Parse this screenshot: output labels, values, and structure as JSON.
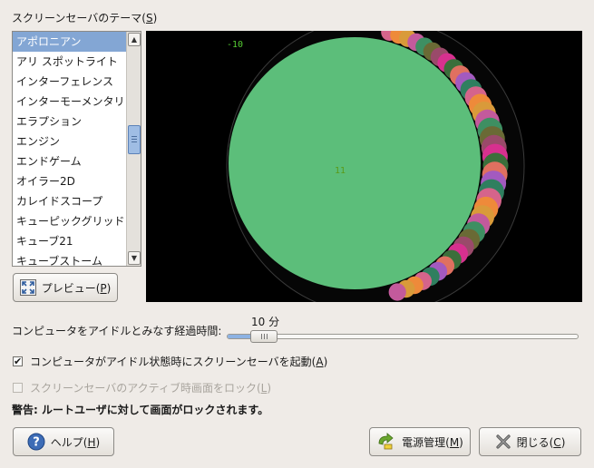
{
  "dialog": {
    "theme_heading": "スクリーンセーバのテーマ(",
    "theme_heading_mnemonic": "S",
    "themes": [
      "アポロニアン",
      "アリ スポットライト",
      "インターフェレンス",
      "インターモーメンタリ",
      "エラプション",
      "エンジン",
      "エンドゲーム",
      "オイラー2D",
      "カレイドスコープ",
      "キューピックグリッド",
      "キューブ21",
      "キューブストーム"
    ],
    "selected_theme": "アポロニアン",
    "preview_button_label": "プレビュー(",
    "preview_button_mnemonic": "P",
    "preview_text_top": "-10",
    "preview_text_center": "11",
    "idle_label": "コンピュータをアイドルとみなす経過時間:",
    "idle_value": "10 分",
    "idle_fraction": 0.11,
    "activate_label": "コンピュータがアイドル状態時にスクリーンセーバを起動(",
    "activate_mnemonic": "A",
    "activate_checked": true,
    "lock_label": "スクリーンセーバのアクティブ時画面をロック(",
    "lock_mnemonic": "L",
    "lock_checked": false,
    "warning_label": "警告:",
    "warning_text": "ルートユーザに対して画面がロックされます。",
    "help_label": "ヘルプ(",
    "help_mnemonic": "H",
    "power_label": "電源管理(",
    "power_mnemonic": "M",
    "close_label": "閉じる(",
    "close_mnemonic": "C"
  },
  "icons": {
    "preview": "fullscreen-arrows-icon",
    "help": "help-question-icon",
    "power": "power-management-icon",
    "close": "close-x-icon",
    "scroll_up": "chevron-up-icon",
    "scroll_down": "chevron-down-icon"
  },
  "colors": {
    "selection": "#83a6d4",
    "big_circle": "#5cbe7a",
    "preview_text": "#55cc33"
  }
}
